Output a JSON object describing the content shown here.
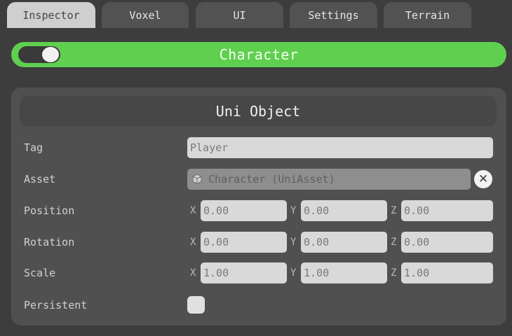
{
  "tabs": [
    {
      "label": "Inspector",
      "active": true
    },
    {
      "label": "Voxel",
      "active": false
    },
    {
      "label": "UI",
      "active": false
    },
    {
      "label": "Settings",
      "active": false
    },
    {
      "label": "Terrain",
      "active": false
    }
  ],
  "header": {
    "title": "Character",
    "toggle_on": true
  },
  "panel": {
    "title": "Uni Object",
    "tag": {
      "label": "Tag",
      "value": "Player"
    },
    "asset": {
      "label": "Asset",
      "value": "Character (UniAsset)",
      "icon": "cube-icon",
      "clear_icon": "close-icon",
      "clear_glyph": "✕"
    },
    "axes": {
      "x": "X",
      "y": "Y",
      "z": "Z"
    },
    "position": {
      "label": "Position",
      "x": "0.00",
      "y": "0.00",
      "z": "0.00"
    },
    "rotation": {
      "label": "Rotation",
      "x": "0.00",
      "y": "0.00",
      "z": "0.00"
    },
    "scale": {
      "label": "Scale",
      "x": "1.00",
      "y": "1.00",
      "z": "1.00"
    },
    "persistent": {
      "label": "Persistent",
      "checked": false
    }
  },
  "colors": {
    "background": "#3d3d3d",
    "accent_green": "#5fcf4f",
    "active_tab": "#cfcfcf",
    "inactive_tab": "#525252",
    "panel": "#505050"
  }
}
